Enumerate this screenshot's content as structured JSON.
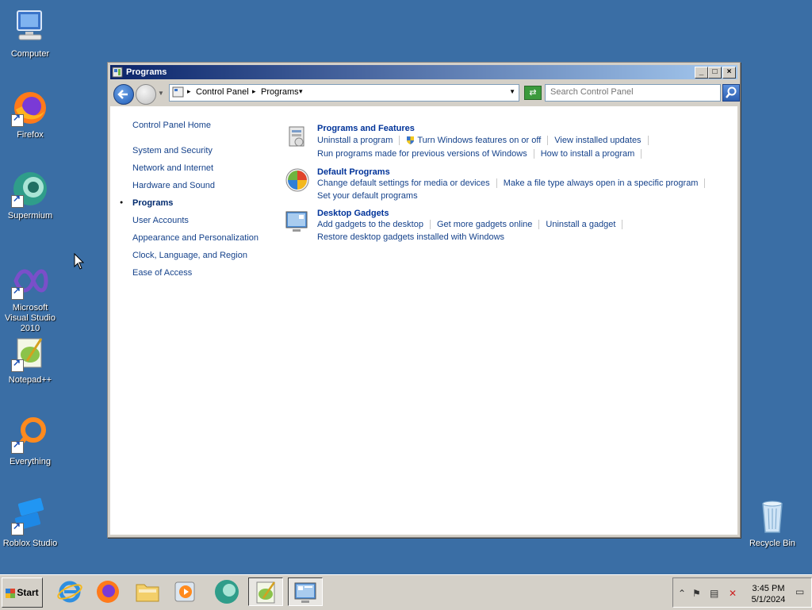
{
  "desktop": {
    "icons": [
      {
        "name": "Computer"
      },
      {
        "name": "Firefox"
      },
      {
        "name": "Supermium"
      },
      {
        "name": "Microsoft Visual Studio 2010"
      },
      {
        "name": "Notepad++"
      },
      {
        "name": "Everything"
      },
      {
        "name": "Roblox Studio"
      },
      {
        "name": "Recycle Bin"
      }
    ]
  },
  "window": {
    "title": "Programs",
    "breadcrumb": [
      "Control Panel",
      "Programs"
    ],
    "search_placeholder": "Search Control Panel"
  },
  "sidebar": {
    "items": [
      {
        "label": "Control Panel Home"
      },
      {
        "label": "System and Security"
      },
      {
        "label": "Network and Internet"
      },
      {
        "label": "Hardware and Sound"
      },
      {
        "label": "Programs",
        "active": true
      },
      {
        "label": "User Accounts"
      },
      {
        "label": "Appearance and Personalization"
      },
      {
        "label": "Clock, Language, and Region"
      },
      {
        "label": "Ease of Access"
      }
    ]
  },
  "sections": [
    {
      "title": "Programs and Features",
      "links": [
        "Uninstall a program",
        "Turn Windows features on or off",
        "View installed updates",
        "Run programs made for previous versions of Windows",
        "How to install a program"
      ]
    },
    {
      "title": "Default Programs",
      "links": [
        "Change default settings for media or devices",
        "Make a file type always open in a specific program",
        "Set your default programs"
      ]
    },
    {
      "title": "Desktop Gadgets",
      "links": [
        "Add gadgets to the desktop",
        "Get more gadgets online",
        "Uninstall a gadget",
        "Restore desktop gadgets installed with Windows"
      ]
    }
  ],
  "taskbar": {
    "start_label": "Start",
    "time": "3:45 PM",
    "date": "5/1/2024"
  }
}
